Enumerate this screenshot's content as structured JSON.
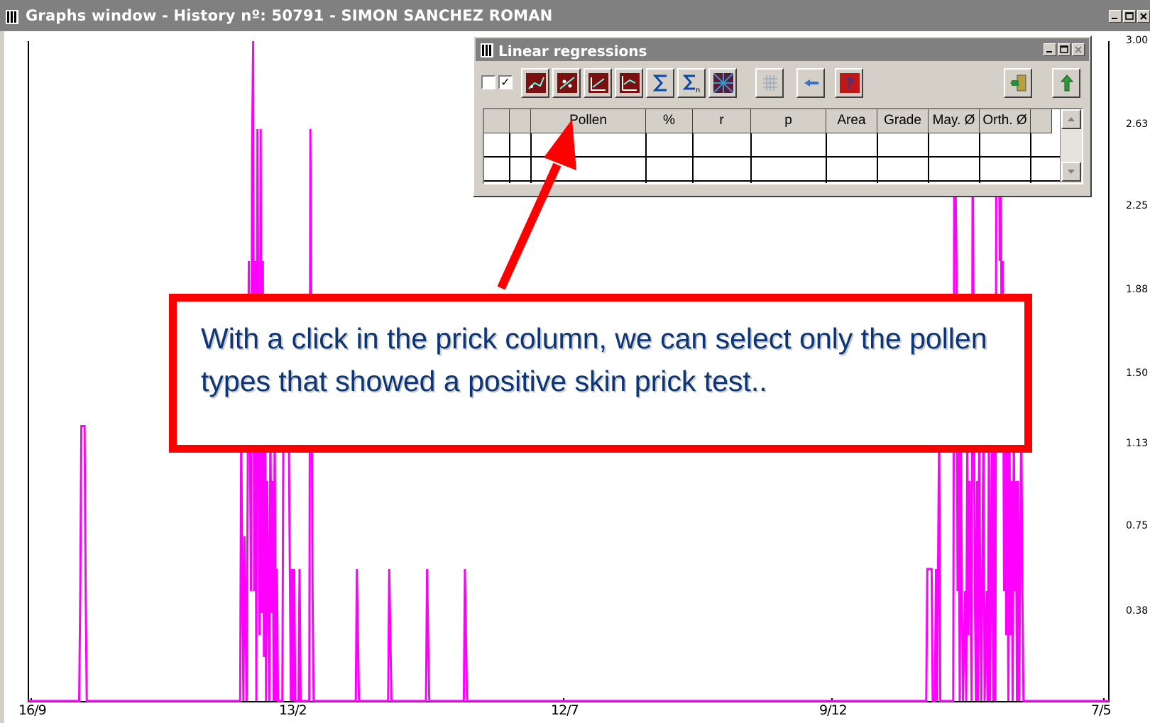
{
  "window": {
    "title": "Graphs window - History nº: 50791 - SIMON SANCHEZ ROMAN",
    "icon": "graph-window-icon"
  },
  "lr_window": {
    "title": "Linear regressions",
    "checkboxes": [
      {
        "name": "unchecked-box",
        "checked": false
      },
      {
        "name": "checked-box",
        "checked": true
      }
    ],
    "toolbar": [
      "regression-type-1-icon",
      "regression-type-2-icon",
      "regression-type-3-icon",
      "regression-type-4-icon",
      "sigma-sum-icon",
      "sigma-n-sum-icon",
      "grid-pattern-icon",
      "grid-toggle-icon",
      "rewind-arrow-icon",
      "help-question-icon",
      "exit-door-icon",
      "up-arrow-icon"
    ],
    "table": {
      "columns": [
        "",
        "",
        "Pollen",
        "%",
        "r",
        "p",
        "Area",
        "Grade",
        "May. Ø",
        "Orth. Ø",
        ""
      ],
      "rows": 2
    }
  },
  "callout": {
    "text": "With a click in the prick column, we can select only the pollen types that showed a positive skin prick test..",
    "border_color": "#ff0000",
    "text_color": "#0b3575"
  },
  "chart_data": {
    "type": "line",
    "x_ticks": [
      "16/9",
      "13/2",
      "12/7",
      "9/12",
      "7/5"
    ],
    "y_ticks": [
      "3.00",
      "2.63",
      "2.25",
      "1.88",
      "1.50",
      "1.13",
      "0.75",
      "0.38"
    ],
    "ylim": [
      0,
      3
    ],
    "series_color": "#ff00ff",
    "series": [
      {
        "values": [
          [
            0.0,
            0
          ],
          [
            0.047,
            0
          ],
          [
            0.048,
            0.5
          ],
          [
            0.049,
            1.25
          ],
          [
            0.052,
            1.25
          ],
          [
            0.053,
            0.5
          ],
          [
            0.054,
            0
          ],
          [
            0.196,
            0
          ],
          [
            0.197,
            1.25
          ],
          [
            0.198,
            0.5
          ],
          [
            0.199,
            0
          ],
          [
            0.2,
            0.75
          ],
          [
            0.202,
            0
          ],
          [
            0.204,
            2.0
          ],
          [
            0.206,
            0.5
          ],
          [
            0.207,
            2.5
          ],
          [
            0.208,
            3.0
          ],
          [
            0.209,
            0.5
          ],
          [
            0.21,
            2.0
          ],
          [
            0.211,
            0
          ],
          [
            0.212,
            2.6
          ],
          [
            0.214,
            0.3
          ],
          [
            0.215,
            2.6
          ],
          [
            0.216,
            0.4
          ],
          [
            0.217,
            2.0
          ],
          [
            0.218,
            0.2
          ],
          [
            0.219,
            1.6
          ],
          [
            0.22,
            0
          ],
          [
            0.221,
            1.0
          ],
          [
            0.223,
            0
          ],
          [
            0.224,
            1.3
          ],
          [
            0.225,
            0.4
          ],
          [
            0.226,
            1.0
          ],
          [
            0.227,
            0
          ],
          [
            0.228,
            1.3
          ],
          [
            0.229,
            0
          ],
          [
            0.23,
            0.6
          ],
          [
            0.231,
            0
          ],
          [
            0.235,
            0
          ],
          [
            0.236,
            1.25
          ],
          [
            0.241,
            1.25
          ],
          [
            0.242,
            0.6
          ],
          [
            0.243,
            0
          ],
          [
            0.244,
            0.6
          ],
          [
            0.245,
            0
          ],
          [
            0.246,
            0.6
          ],
          [
            0.247,
            0
          ],
          [
            0.25,
            0
          ],
          [
            0.251,
            0.6
          ],
          [
            0.252,
            0
          ],
          [
            0.26,
            0
          ],
          [
            0.261,
            2.6
          ],
          [
            0.262,
            1.6
          ],
          [
            0.263,
            0.5
          ],
          [
            0.264,
            0
          ],
          [
            0.303,
            0
          ],
          [
            0.304,
            0.6
          ],
          [
            0.305,
            0.3
          ],
          [
            0.306,
            0
          ],
          [
            0.333,
            0
          ],
          [
            0.334,
            0.6
          ],
          [
            0.335,
            0.3
          ],
          [
            0.336,
            0
          ],
          [
            0.368,
            0
          ],
          [
            0.369,
            0.6
          ],
          [
            0.37,
            0.3
          ],
          [
            0.371,
            0
          ],
          [
            0.403,
            0
          ],
          [
            0.404,
            0.6
          ],
          [
            0.405,
            0.3
          ],
          [
            0.406,
            0
          ],
          [
            0.831,
            0
          ],
          [
            0.832,
            0.6
          ],
          [
            0.836,
            0.6
          ],
          [
            0.837,
            0
          ],
          [
            0.839,
            0
          ],
          [
            0.84,
            0.6
          ],
          [
            0.841,
            0
          ],
          [
            0.843,
            1.25
          ],
          [
            0.844,
            0
          ],
          [
            0.856,
            0
          ],
          [
            0.857,
            2.6
          ],
          [
            0.858,
            2.4
          ],
          [
            0.859,
            2.0
          ],
          [
            0.86,
            0.5
          ],
          [
            0.861,
            1.25
          ],
          [
            0.862,
            0
          ],
          [
            0.863,
            1.25
          ],
          [
            0.864,
            0.5
          ],
          [
            0.865,
            0
          ],
          [
            0.867,
            0.5
          ],
          [
            0.868,
            0
          ],
          [
            0.869,
            1.25
          ],
          [
            0.87,
            0.3
          ],
          [
            0.871,
            1.0
          ],
          [
            0.872,
            0.5
          ],
          [
            0.873,
            0
          ],
          [
            0.874,
            2.6
          ],
          [
            0.875,
            1.5
          ],
          [
            0.876,
            0.5
          ],
          [
            0.877,
            0
          ],
          [
            0.878,
            1.0
          ],
          [
            0.879,
            0
          ],
          [
            0.88,
            1.25
          ],
          [
            0.881,
            0.5
          ],
          [
            0.882,
            0
          ],
          [
            0.884,
            1.25
          ],
          [
            0.885,
            0
          ],
          [
            0.887,
            0.5
          ],
          [
            0.888,
            0
          ],
          [
            0.889,
            1.25
          ],
          [
            0.89,
            0
          ],
          [
            0.892,
            1.25
          ],
          [
            0.893,
            0
          ],
          [
            0.894,
            1.3
          ],
          [
            0.895,
            0
          ],
          [
            0.896,
            3.0
          ],
          [
            0.898,
            3.0
          ],
          [
            0.899,
            2.0
          ],
          [
            0.9,
            2.3
          ],
          [
            0.901,
            1.5
          ],
          [
            0.902,
            2.0
          ],
          [
            0.903,
            0.5
          ],
          [
            0.904,
            1.8
          ],
          [
            0.905,
            0.3
          ],
          [
            0.906,
            1.25
          ],
          [
            0.907,
            0
          ],
          [
            0.908,
            1.3
          ],
          [
            0.909,
            0.3
          ],
          [
            0.91,
            1.0
          ],
          [
            0.911,
            0
          ],
          [
            0.912,
            1.25
          ],
          [
            0.913,
            0.5
          ],
          [
            0.914,
            1.0
          ],
          [
            0.915,
            0
          ],
          [
            0.916,
            1.0
          ],
          [
            0.917,
            0
          ],
          [
            0.919,
            1.3
          ],
          [
            0.92,
            0.5
          ],
          [
            0.921,
            0
          ],
          [
            1.0,
            0
          ]
        ]
      }
    ]
  }
}
